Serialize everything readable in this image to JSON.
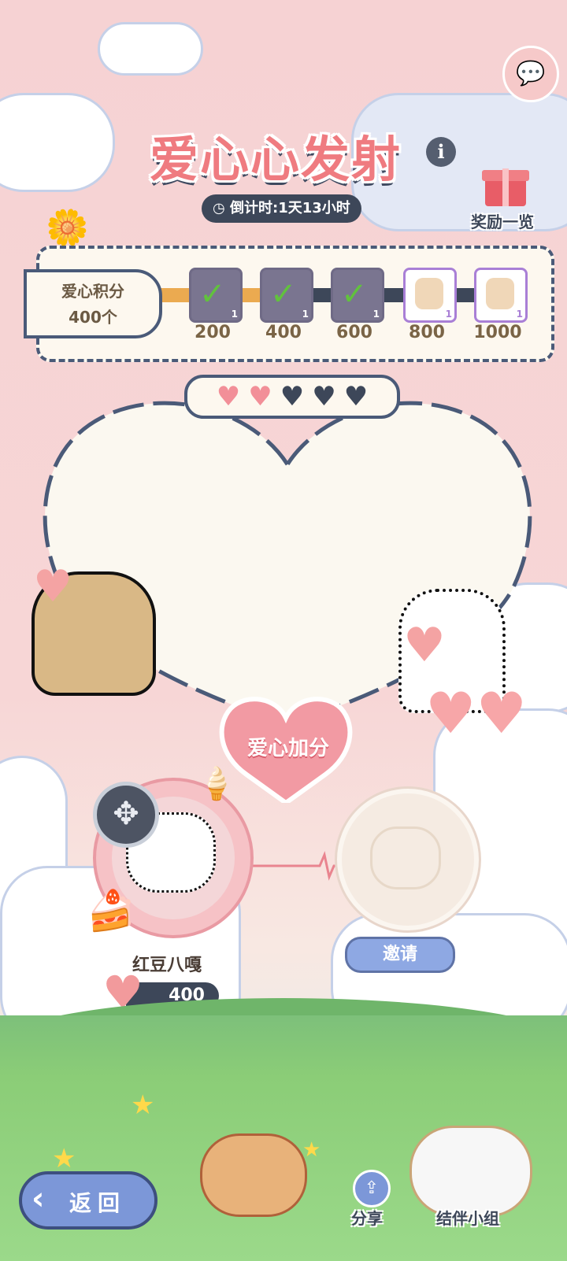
{
  "event": {
    "title": "爱心心发射",
    "countdown": "倒计时:1天13小时",
    "rewards_label": "奖励一览"
  },
  "progress": {
    "score_label": "爱心积分",
    "score_value": "400个",
    "tiers": [
      {
        "label": "200",
        "count": "1",
        "state": "claimed"
      },
      {
        "label": "400",
        "count": "1",
        "state": "claimed"
      },
      {
        "label": "600",
        "count": "1",
        "state": "claimed"
      },
      {
        "label": "800",
        "count": "1",
        "state": "open"
      },
      {
        "label": "1000",
        "count": "1",
        "state": "open"
      }
    ],
    "fill_fraction": 0.4
  },
  "hearts": {
    "filled": 2,
    "total": 5
  },
  "boost_label": "爱心加分",
  "player": {
    "name": "红豆八嘎",
    "score": "400"
  },
  "invite_label": "邀请",
  "nav": {
    "back_label": "返回",
    "share_label": "分享",
    "team_label": "结伴小组"
  },
  "colors": {
    "accent": "#ef7b80",
    "dark": "#3d4759",
    "button_blue": "#7c97d8"
  }
}
